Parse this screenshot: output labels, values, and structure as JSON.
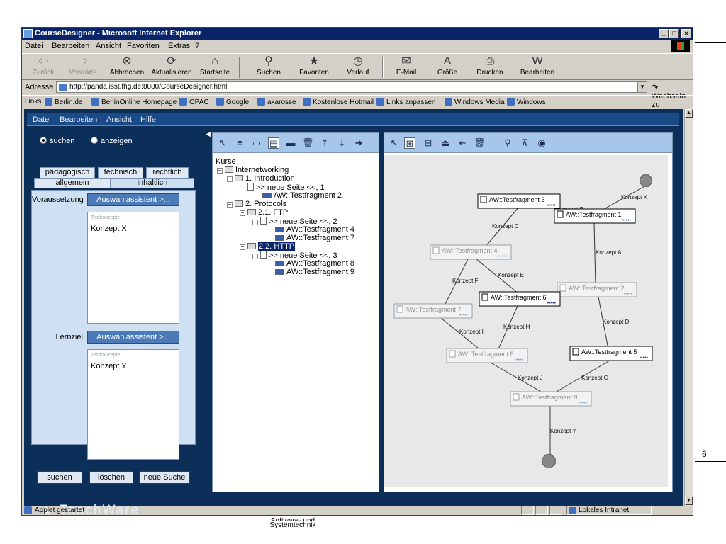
{
  "window": {
    "title": "CourseDesigner - Microsoft Internet Explorer",
    "controls": [
      "_",
      "□",
      "×"
    ]
  },
  "ie_menu": [
    "Datei",
    "Bearbeiten",
    "Ansicht",
    "Favoriten",
    "Extras",
    "?"
  ],
  "toolbar": {
    "back": "Zurück",
    "forward": "Vorwärts",
    "stop": "Abbrechen",
    "refresh": "Aktualisieren",
    "home": "Startseite",
    "search": "Suchen",
    "favorites": "Favoriten",
    "history": "Verlauf",
    "mail": "E-Mail",
    "size": "Größe",
    "print": "Drucken",
    "edit": "Bearbeiten"
  },
  "address": {
    "label": "Adresse",
    "url": "http://panda.isst.fhg.de:8080/CourseDesigner.html",
    "go": "Wechseln zu"
  },
  "links": {
    "label": "Links",
    "items": [
      "Berlin.de",
      "BerlinOnline Homepage",
      "OPAC",
      "Google",
      "akarosse",
      "Kostenlose Hotmail",
      "Links anpassen",
      "Windows Media",
      "Windows"
    ]
  },
  "applet_menu": [
    "Datei",
    "Bearbeiten",
    "Ansicht",
    "Hilfe"
  ],
  "mode": {
    "search": "suchen",
    "show": "anzeigen"
  },
  "tabs": {
    "row1": [
      "pädagogisch",
      "technisch",
      "rechtlich"
    ],
    "row2": [
      "allgemein",
      "inhaltlich"
    ]
  },
  "form": {
    "prereq_label": "Voraussetzung",
    "goal_label": "Lernziel",
    "assist": "Auswahlassistent >...",
    "list_header": "Testkonzepte",
    "prereq_value": "Konzept X",
    "goal_value": "Konzept Y"
  },
  "buttons": {
    "search": "suchen",
    "delete": "löschen",
    "new_search": "neue Suche"
  },
  "logo": {
    "name": "TeachWare",
    "tagline": "COURSE DESIGNER TOOL"
  },
  "tree": {
    "root": "Kurse",
    "course": "Internetworking",
    "ch1": "1. Introduction",
    "ch1_page": ">> neue Seite <<, 1",
    "frag2": "AW::Testfragment 2",
    "ch2": "2. Protocols",
    "ch21": "2.1. FTP",
    "ch21_page": ">> neue Seite <<, 2",
    "frag4": "AW::Testfragment 4",
    "frag7": "AW::Testfragment 7",
    "ch22": "2.2. HTTP",
    "ch22_page": ">> neue Seite <<, 3",
    "frag8": "AW::Testfragment 8",
    "frag9": "AW::Testfragment 9"
  },
  "graph": {
    "nodes": {
      "tf1": "AW::Testfragment 1",
      "tf2": "AW::Testfragment 2",
      "tf3": "AW::Testfragment 3",
      "tf4": "AW::Testfragment 4",
      "tf5": "AW::Testfragment 5",
      "tf6": "AW::Testfragment 6",
      "tf7": "AW::Testfragment 7",
      "tf8": "AW::Testfragment 8",
      "tf9": "AW::Testfragment 9"
    },
    "rating": "•••••",
    "edges": {
      "x": "Konzept X",
      "b": "Konzept B",
      "c": "Konzept C",
      "a": "Konzept A",
      "e": "Konzept E",
      "f": "Konzept F",
      "d": "Konzept D",
      "h": "Konzept H",
      "i": "Konzept I",
      "j": "Konzept J",
      "g": "Konzept G",
      "y": "Konzept Y"
    }
  },
  "status": {
    "text": "Applet gestartet",
    "zone": "Lokales Intranet"
  },
  "page_footer": {
    "line1": "Software- und",
    "line2": "Systemtechnik"
  },
  "page_number": "6"
}
